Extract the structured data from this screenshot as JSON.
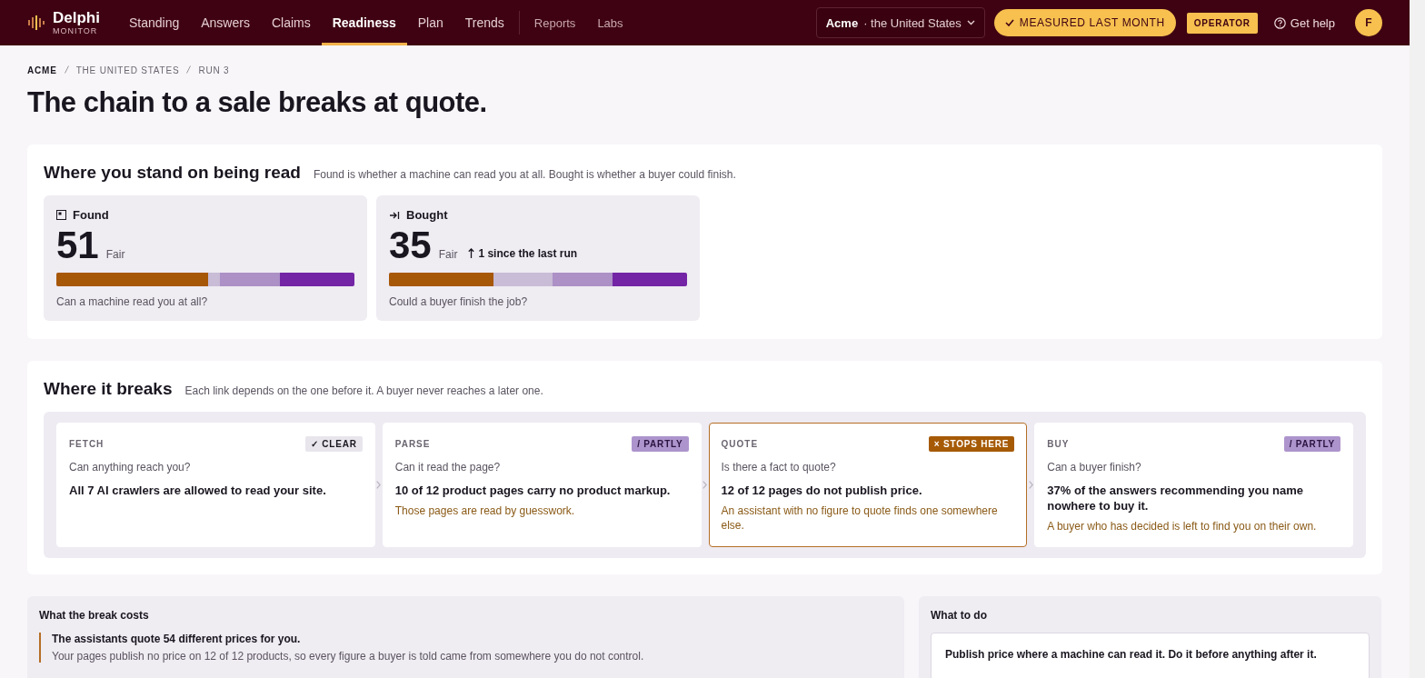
{
  "brand": {
    "name": "Delphi",
    "subtitle": "MONITOR"
  },
  "nav": [
    {
      "label": "Standing",
      "selected": false,
      "kind": "main"
    },
    {
      "label": "Answers",
      "selected": false,
      "kind": "main"
    },
    {
      "label": "Claims",
      "selected": false,
      "kind": "main"
    },
    {
      "label": "Readiness",
      "selected": true,
      "kind": "main"
    },
    {
      "label": "Plan",
      "selected": false,
      "kind": "main"
    },
    {
      "label": "Trends",
      "selected": false,
      "kind": "main"
    },
    {
      "label": "Reports",
      "selected": false,
      "kind": "secondary"
    },
    {
      "label": "Labs",
      "selected": false,
      "kind": "secondary"
    }
  ],
  "scope": {
    "company": "Acme",
    "market": "· the United States"
  },
  "measured": "MEASURED LAST MONTH",
  "role": "OPERATOR",
  "help": "Get help",
  "avatar": "F",
  "breadcrumb": [
    "ACME",
    "THE UNITED STATES",
    "RUN 3"
  ],
  "title": "The chain to a sale breaks at quote.",
  "standing": {
    "title": "Where you stand on being read",
    "note": "Found is whether a machine can read you at all. Bought is whether a buyer could finish.",
    "scores": [
      {
        "kind": "found",
        "label": "Found",
        "value": "51",
        "grade": "Fair",
        "level": 0.51,
        "question": "Can a machine read you at all?"
      },
      {
        "kind": "bought",
        "label": "Bought",
        "value": "35",
        "grade": "Fair",
        "change": "1 since the last run",
        "level": 0.35,
        "question": "Could a buyer finish the job?"
      }
    ]
  },
  "chain": {
    "title": "Where it breaks",
    "note": "Each link depends on the one before it. A buyer never reaches a later one.",
    "links": [
      {
        "step": "FETCH",
        "kind": "clear",
        "badge": "✓ CLEAR",
        "question": "Can anything reach you?",
        "finding": "All 7 AI crawlers are allowed to read your site."
      },
      {
        "step": "PARSE",
        "kind": "partly",
        "badge": "/ PARTLY",
        "question": "Can it read the page?",
        "finding": "10 of 12 product pages carry no product markup.",
        "consequence": "Those pages are read by guesswork."
      },
      {
        "step": "QUOTE",
        "kind": "stops",
        "badge": "× STOPS HERE",
        "question": "Is there a fact to quote?",
        "finding": "12 of 12 pages do not publish price.",
        "consequence": "An assistant with no figure to quote finds one somewhere else."
      },
      {
        "step": "BUY",
        "kind": "partly",
        "badge": "/ PARTLY",
        "question": "Can a buyer finish?",
        "finding": "37% of the answers recommending you name nowhere to buy it.",
        "consequence": "A buyer who has decided is left to find you on their own."
      }
    ]
  },
  "cost": {
    "title": "What the break costs",
    "headline": "The assistants quote 54 different prices for you.",
    "detail": "Your pages publish no price on 12 of 12 products, so every figure a buyer is told came from somewhere you do not control."
  },
  "todo": {
    "title": "What to do",
    "action": "Publish price where a machine can read it. Do it before anything after it."
  }
}
